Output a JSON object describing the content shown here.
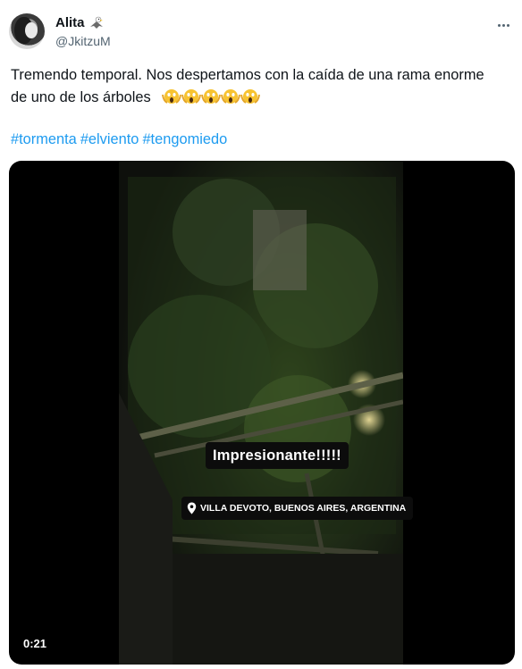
{
  "author": {
    "display_name": "Alita",
    "name_emoji_icon": "eagle-icon",
    "handle": "@JkitzuM"
  },
  "tweet": {
    "text_line1": "Tremendo temporal. Nos despertamos con la caída de una rama enorme",
    "text_line2": "de uno de los árboles",
    "emoji_icon": "face-screaming-in-fear-icon",
    "emoji_count": 5,
    "hashtags": [
      "#tormenta",
      "#elviento",
      "#tengomiedo"
    ],
    "link_color": "#1d9bf0"
  },
  "media": {
    "type": "video",
    "overlay_caption": "Impresionante!!!!!",
    "location_sticker": "VILLA DEVOTO, BUENOS AIRES, ARGENTINA",
    "duration": "0:21"
  }
}
